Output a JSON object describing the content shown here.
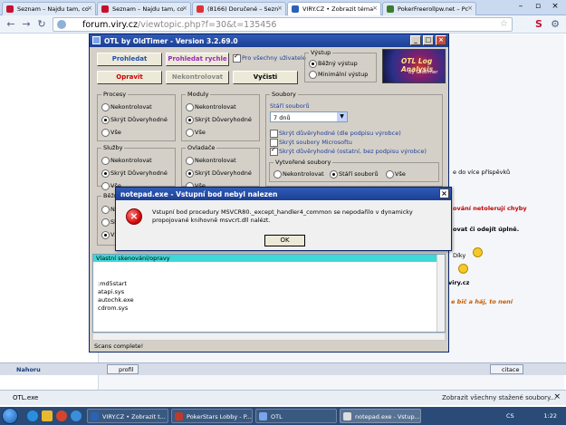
{
  "browser": {
    "tabs": [
      {
        "label": "Seznam – Najdu tam, co",
        "color": "#c8102e"
      },
      {
        "label": "Seznam – Najdu tam, co",
        "color": "#c8102e"
      },
      {
        "label": "(8166) Doručené – Sezn",
        "color": "#d33"
      },
      {
        "label": "VIRY.CZ • Zobrazit téma",
        "color": "#2a62b8"
      },
      {
        "label": "PokerFreerollpw.net – Pc",
        "color": "#3a7d2a"
      }
    ],
    "url_host": "forum.viry.cz",
    "url_path": "/viewtopic.php?f=30&t=135456"
  },
  "page": {
    "snippets": {
      "more_posts": "e do více příspěvků",
      "nettolerate": "ování netolerují chyby",
      "odejit": "ovat či odejít úplně.",
      "diky": "Díky",
      "viry": "viry.cz",
      "bic": "e bič a háj, to není"
    },
    "nahoru": "Nahoru",
    "profil": "profil",
    "citace": "citace"
  },
  "otl": {
    "title": "OTL by OldTimer - Version 3.2.69.0",
    "buttons": {
      "scan": "Prohledat",
      "quick_scan": "Prohledat rychle",
      "fix": "Opravit",
      "no_check": "Nekontrolovat",
      "clean": "Vyčisti"
    },
    "all_users": "Pro všechny uživatele",
    "output": {
      "title": "Výstup",
      "standard": "Běžný výstup",
      "minimal": "Minimální výstup"
    },
    "logo": {
      "t1": "OTL Log Analysis",
      "t2": "by Oldtimer"
    },
    "processes": {
      "title": "Procesy",
      "opt1": "Nekontrolovat",
      "opt2": "Skrýt Důveryhodné",
      "opt3": "Vše"
    },
    "modules": {
      "title": "Moduly",
      "opt1": "Nekontrolovat",
      "opt2": "Skrýt Důveryhodné",
      "opt3": "Vše"
    },
    "services": {
      "title": "Služby",
      "opt1": "Nekontrolovat",
      "opt2": "Skrýt Důveryhodné",
      "opt3": "Vše"
    },
    "drivers": {
      "title": "Ovladače",
      "opt1": "Nekontrolovat",
      "opt2": "Skrýt Důveryhodné",
      "opt3": "Vše"
    },
    "files": {
      "title": "Soubory",
      "age_label": "Stáří souborů",
      "age_value": "7 dnů",
      "hide_trusted": "Skrýt důvěryhodné (dle podpisu výrobce)",
      "hide_ms": "Skrýt soubory Microsoftu",
      "hide_trusted_other": "Skrýt důvěryhodné (ostatní, bez podpisu výrobce)"
    },
    "created": {
      "title": "Vytvořené soubory",
      "opt1": "Nekontrolovat",
      "opt2": "Stáří souborů",
      "opt3": "Vše"
    },
    "bottom_left": {
      "title": "Běžn",
      "a": "Ne",
      "b": "Sk",
      "c": "Vš"
    },
    "custom_scans": "Vlastní skenování/opravy",
    "output_lines": [
      ":md5start",
      "atapi.sys",
      "autochk.exe",
      "cdrom.sys"
    ],
    "status": "Scans complete!"
  },
  "dialog": {
    "title": "notepad.exe - Vstupní bod nebyl nalezen",
    "message": "Vstupní bod procedury MSVCR80._except_handler4_common se nepodařilo v dynamicky propojované knihovně msvcrt.dll nalézt.",
    "ok": "OK"
  },
  "downloads": {
    "file": "OTL.exe",
    "show_all": "Zobrazit všechny stažené soubory..."
  },
  "taskbar": {
    "items": [
      {
        "label": "VIRY.CZ • Zobrazit t...",
        "color": "#2a62b8"
      },
      {
        "label": "PokerStars Lobby - P...",
        "color": "#c0392b"
      },
      {
        "label": "OTL",
        "color": "#1c3f93"
      },
      {
        "label": "notepad.exe - Vstup...",
        "color": "#ddd"
      }
    ],
    "lang": "CS",
    "clock": "1:22"
  }
}
